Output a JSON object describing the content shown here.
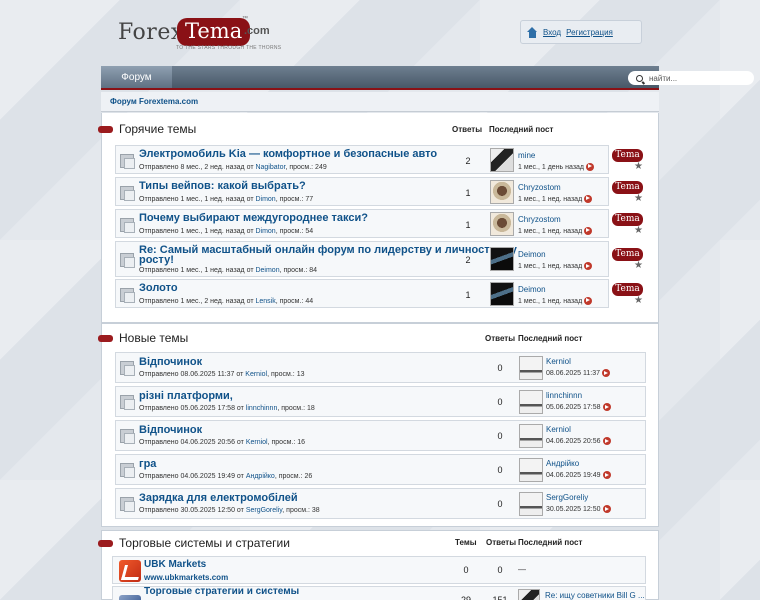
{
  "header": {
    "logo": {
      "forex": "Forex",
      "tema": "Tema",
      "tm": "™",
      "com": ".com",
      "tagline": "TO THE STARS THROUGH THE THORNS"
    },
    "login": "Вход",
    "register": "Регистрация"
  },
  "nav": {
    "forum_tab": "Форум",
    "search_placeholder": "найти..."
  },
  "breadcrumb": "Форум Forextema.com",
  "hot": {
    "title": "Горячие темы",
    "col_replies": "Ответы",
    "col_last": "Последний пост",
    "badge": "Tema",
    "topics": [
      {
        "title": "Электромобиль Kia — комфортное и безопасные авто",
        "meta_pre": "Отправлено 8 мес., 2 нед. назад  от ",
        "author": "Nagibator",
        "meta_post": ", просм.: 249",
        "replies": "2",
        "lp_user": "mine",
        "lp_time": "1 мес., 1 день назад",
        "avatar": "av-dark"
      },
      {
        "title": "Типы вейпов: какой выбрать?",
        "meta_pre": "Отправлено 1 мес., 1 нед. назад  от ",
        "author": "Dimon",
        "meta_post": ", просм.: 77",
        "replies": "1",
        "lp_user": "Chryzostom",
        "lp_time": "1 мес., 1 нед. назад",
        "avatar": "av-face"
      },
      {
        "title": "Почему выбирают междугороднее такси?",
        "meta_pre": "Отправлено 1 мес., 1 нед. назад  от ",
        "author": "Dimon",
        "meta_post": ", просм.: 54",
        "replies": "1",
        "lp_user": "Chryzostom",
        "lp_time": "1 мес., 1 нед. назад",
        "avatar": "av-face"
      },
      {
        "title": "Re: Самый масштабный онлайн форум по лидерству и личностному",
        "title2": "росту!",
        "meta_pre": "Отправлено 1 мес., 1 нед. назад  от ",
        "author": "Deimon",
        "meta_post": ", просм.: 84",
        "replies": "2",
        "lp_user": "Deimon",
        "lp_time": "1 мес., 1 нед. назад",
        "avatar": "av-car"
      },
      {
        "title": "Золото",
        "meta_pre": "Отправлено 1 мес., 2 нед. назад  от ",
        "author": "Lensik",
        "meta_post": ", просм.: 44",
        "replies": "1",
        "lp_user": "Deimon",
        "lp_time": "1 мес., 1 нед. назад",
        "avatar": "av-car"
      }
    ]
  },
  "new": {
    "title": "Новые темы",
    "col_replies": "Ответы",
    "col_last": "Последний пост",
    "topics": [
      {
        "title": "Відпочинок",
        "meta_pre": "Отправлено 08.06.2025 11:37  от ",
        "author": "Kerniol",
        "meta_post": ", просм.: 13",
        "replies": "0",
        "lp_user": "Kerniol",
        "lp_time": "08.06.2025 11:37"
      },
      {
        "title": "різні платформи,",
        "meta_pre": "Отправлено 05.06.2025 17:58  от ",
        "author": "linnchinnn",
        "meta_post": ", просм.: 18",
        "replies": "0",
        "lp_user": "linnchinnn",
        "lp_time": "05.06.2025 17:58"
      },
      {
        "title": "Відпочинок",
        "meta_pre": "Отправлено 04.06.2025 20:56  от ",
        "author": "Kerniol",
        "meta_post": ", просм.: 16",
        "replies": "0",
        "lp_user": "Kerniol",
        "lp_time": "04.06.2025 20:56"
      },
      {
        "title": "гра",
        "meta_pre": "Отправлено 04.06.2025 19:49  от ",
        "author": "Андрійко",
        "meta_post": ", просм.: 26",
        "replies": "0",
        "lp_user": "Андрійко",
        "lp_time": "04.06.2025 19:49"
      },
      {
        "title": "Зарядка для електромобілей",
        "meta_pre": "Отправлено 30.05.2025 12:50  от ",
        "author": "SergGoreliy",
        "meta_post": ", просм.: 38",
        "replies": "0",
        "lp_user": "SergGoreliy",
        "lp_time": "30.05.2025 12:50"
      }
    ]
  },
  "systems": {
    "title": "Торговые системы и стратегии",
    "col_topics": "Темы",
    "col_replies": "Ответы",
    "col_last": "Последний пост",
    "forums": [
      {
        "name": "UBK Markets",
        "sub": "www.ubkmarkets.com",
        "topics": "0",
        "replies": "0",
        "last": "—"
      },
      {
        "name": "Торговые стратегии и системы",
        "topics": "29",
        "replies": "151",
        "last": "Re: ищу советники Bill G ..."
      }
    ]
  }
}
